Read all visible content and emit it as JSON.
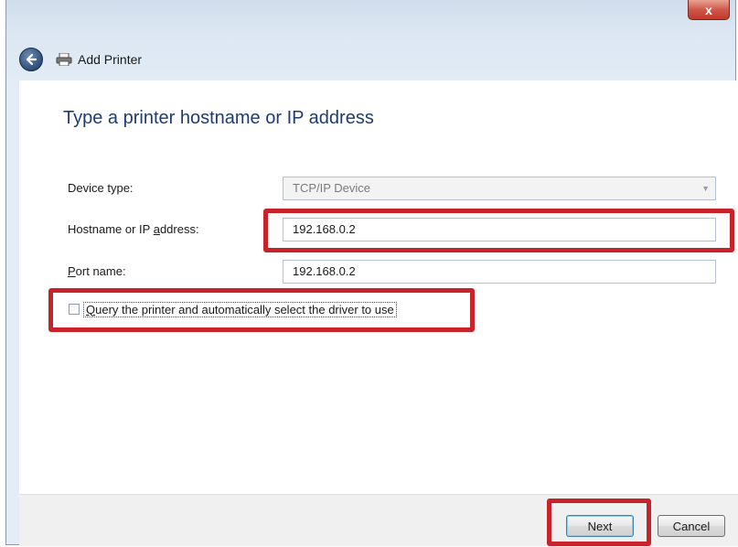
{
  "window": {
    "title": "Add Printer",
    "close_glyph": "x"
  },
  "header": {
    "back_icon": "back-arrow-icon",
    "printer_icon": "printer-icon"
  },
  "content": {
    "instruction": "Type a printer hostname or IP address",
    "fields": {
      "device_type": {
        "label": "Device type:",
        "value": "TCP/IP Device"
      },
      "hostname": {
        "label_pre": "Hostname or IP ",
        "label_accel": "a",
        "label_post": "ddress:",
        "value": "192.168.0.2"
      },
      "port_name": {
        "label_accel": "P",
        "label_post": "ort name:",
        "value": "192.168.0.2"
      }
    },
    "checkbox": {
      "accel": "Q",
      "label_rest": "uery the printer and automatically select the driver to use",
      "checked": false
    }
  },
  "footer": {
    "next_label": "Next",
    "cancel_label": "Cancel"
  },
  "colors": {
    "highlight": "#c8232b",
    "instruction": "#1e3c72"
  }
}
